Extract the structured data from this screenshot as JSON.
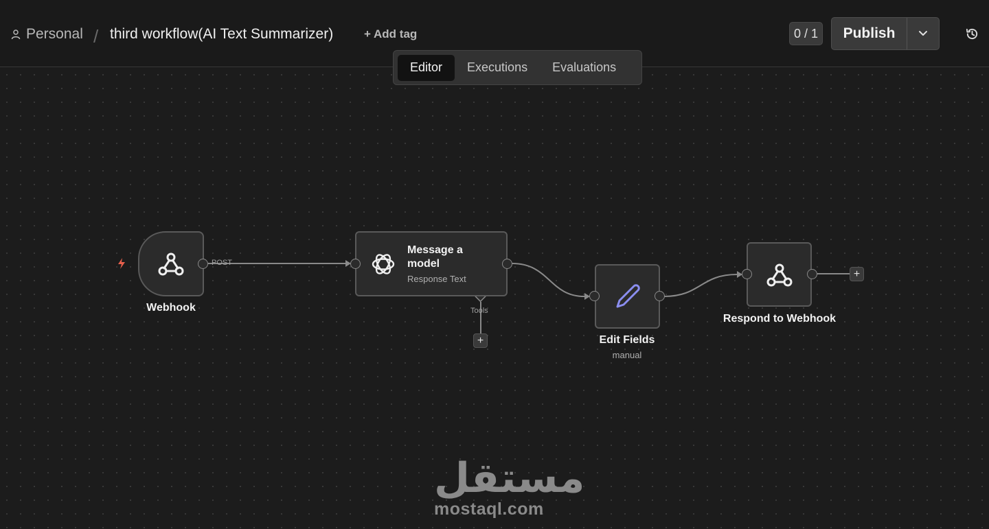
{
  "header": {
    "workspace": "Personal",
    "separator": "/",
    "workflow_title": "third workflow(AI Text Summarizer)",
    "add_tag": "+ Add tag",
    "counter": "0 / 1",
    "publish_label": "Publish"
  },
  "tabs": [
    {
      "label": "Editor",
      "active": true
    },
    {
      "label": "Executions",
      "active": false
    },
    {
      "label": "Evaluations",
      "active": false
    }
  ],
  "nodes": {
    "webhook": {
      "label": "Webhook",
      "icon": "webhook-icon"
    },
    "message_model": {
      "title": "Message a model",
      "subtitle": "Response Text",
      "icon": "openai-icon"
    },
    "edit_fields": {
      "label": "Edit Fields",
      "subtitle": "manual",
      "icon": "pencil-icon"
    },
    "respond": {
      "label": "Respond to Webhook",
      "icon": "webhook-icon"
    }
  },
  "edges": {
    "post_label": "POST",
    "tools_label": "Tools"
  },
  "plus": "+",
  "watermark": {
    "arabic": "مستقل",
    "latin": "mostaql.com"
  },
  "colors": {
    "background": "#1a1a1a",
    "node": "#2b2b2b",
    "trigger_bolt": "#e8604c",
    "pencil": "#8b8ef0"
  }
}
